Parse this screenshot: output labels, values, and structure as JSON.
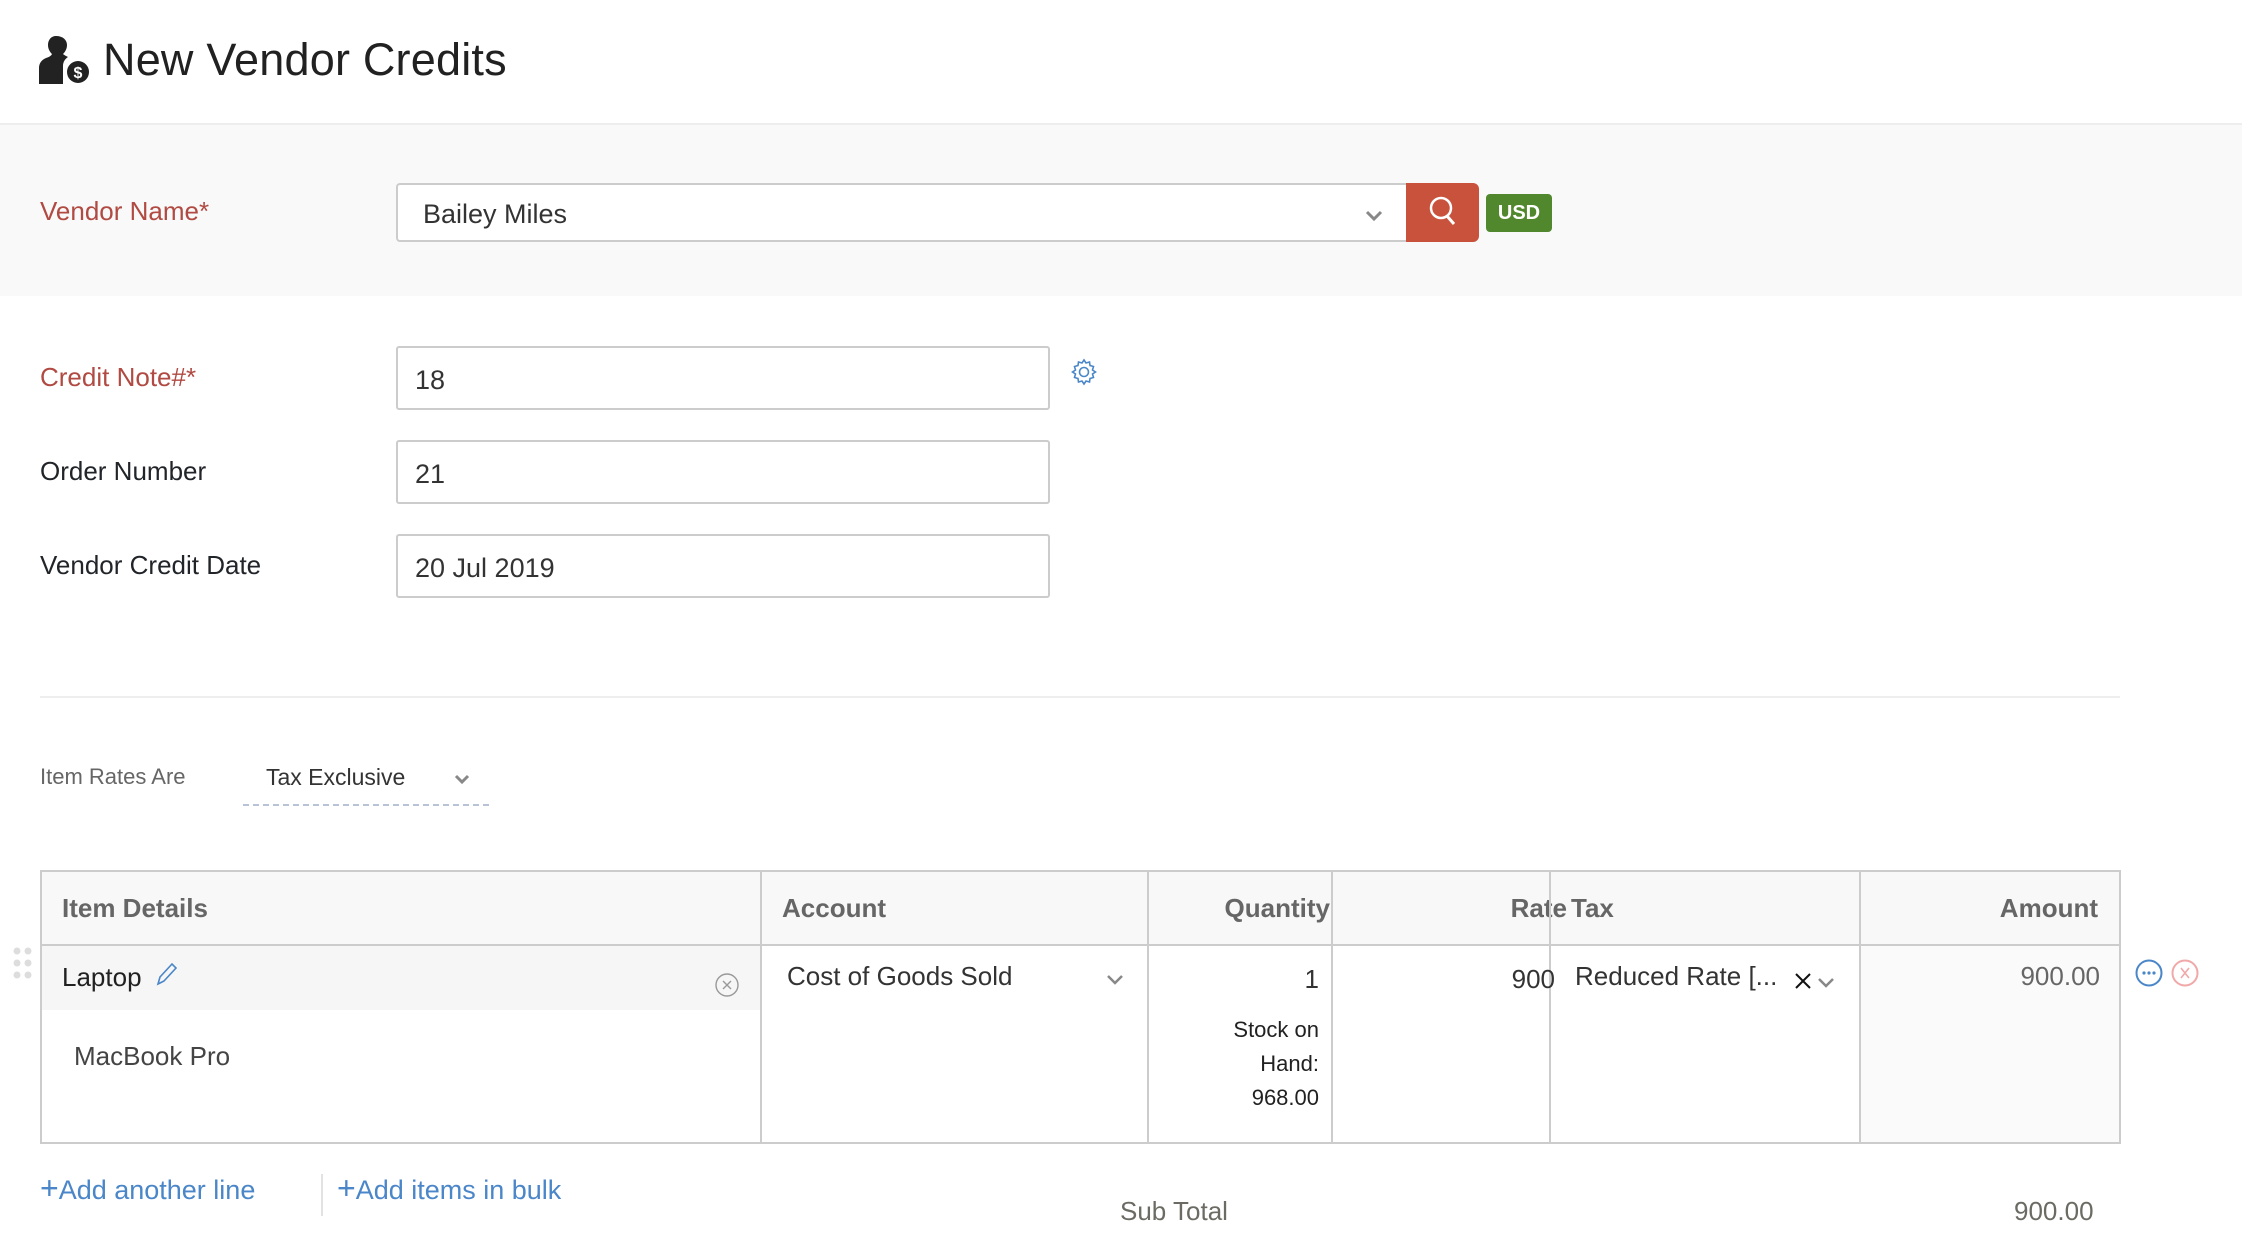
{
  "header": {
    "title": "New Vendor Credits",
    "icon": "vendor-credit-icon"
  },
  "vendor": {
    "label": "Vendor Name*",
    "value": "Bailey Miles",
    "currency": "USD",
    "colors": {
      "label": "#b04a42",
      "search_button": "#c8523b",
      "currency_badge": "#52882d"
    }
  },
  "fields": {
    "credit_note": {
      "label": "Credit Note#*",
      "value": "18"
    },
    "order_number": {
      "label": "Order Number",
      "value": "21"
    },
    "vendor_credit_date": {
      "label": "Vendor Credit Date",
      "value": "20 Jul 2019"
    }
  },
  "item_rates": {
    "label": "Item Rates Are",
    "value": "Tax Exclusive"
  },
  "table": {
    "columns": [
      "Item Details",
      "Account",
      "Quantity",
      "Rate",
      "Tax",
      "Amount"
    ],
    "rows": [
      {
        "item": "Laptop",
        "description": "MacBook Pro",
        "account": "Cost of Goods Sold",
        "quantity": "1",
        "stock_label_1": "Stock on",
        "stock_label_2": "Hand:",
        "stock_value": "968.00",
        "rate": "900",
        "tax": "Reduced Rate [...",
        "amount": "900.00"
      }
    ]
  },
  "footer": {
    "add_line": "Add another line",
    "add_bulk": "Add items in bulk",
    "subtotal_label": "Sub Total",
    "subtotal_value": "900.00"
  }
}
